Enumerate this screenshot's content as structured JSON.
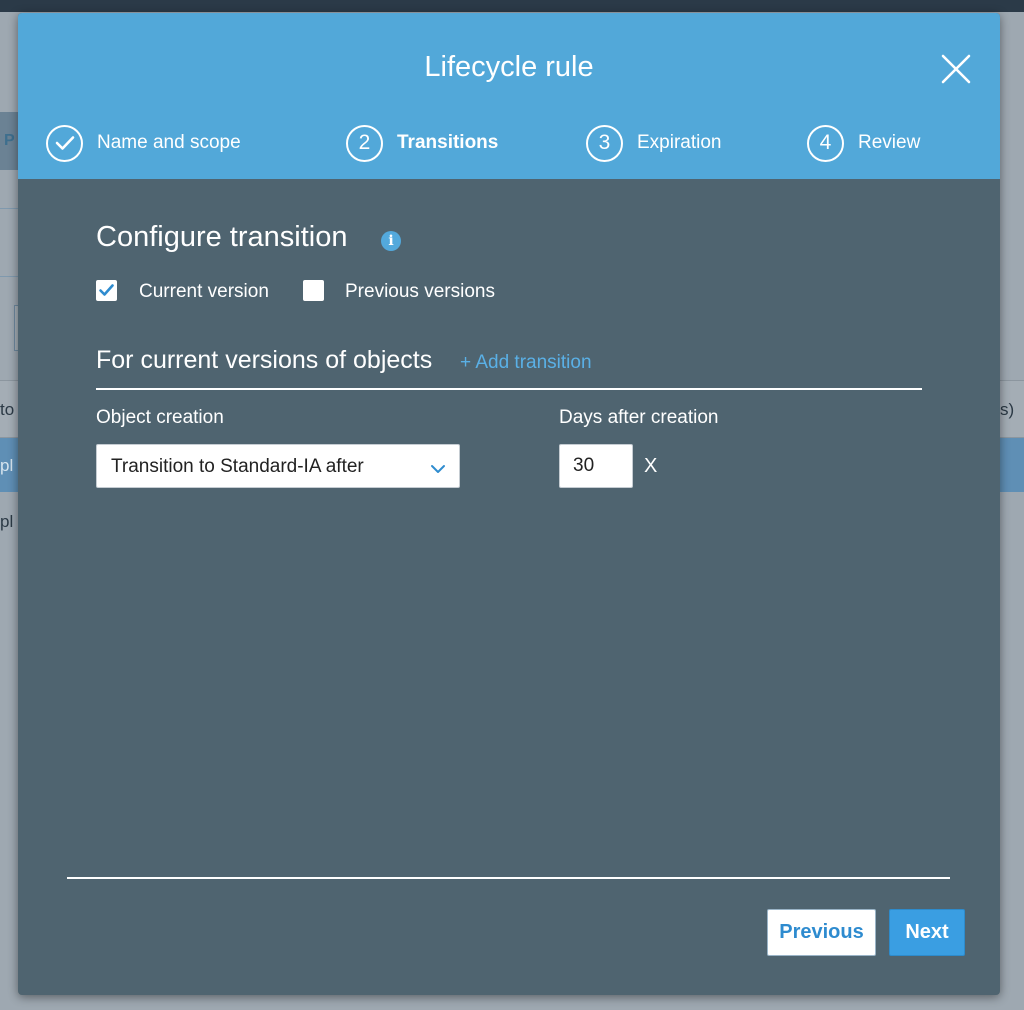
{
  "background": {
    "tab_fragment": "P",
    "header_fragment_left": "to",
    "header_fragment_right": "s)",
    "row_fragment_1": "pl",
    "row_fragment_2": "pl"
  },
  "modal": {
    "title": "Lifecycle rule",
    "close_icon": "close-icon"
  },
  "steps": [
    {
      "number": "",
      "label": "Name and scope",
      "state": "completed",
      "icon": "check-icon"
    },
    {
      "number": "2",
      "label": "Transitions",
      "state": "current"
    },
    {
      "number": "3",
      "label": "Expiration",
      "state": "upcoming"
    },
    {
      "number": "4",
      "label": "Review",
      "state": "upcoming"
    }
  ],
  "configure": {
    "title": "Configure transition",
    "info_icon": "info-icon",
    "current_version_label": "Current version",
    "current_version_checked": true,
    "previous_versions_label": "Previous versions",
    "previous_versions_checked": false
  },
  "current_versions": {
    "title": "For current versions of objects",
    "add_transition": "+ Add transition",
    "object_creation_label": "Object creation",
    "object_creation_value": "Transition to Standard-IA after",
    "days_label": "Days after creation",
    "days_value": "30",
    "remove_label": "X"
  },
  "footer": {
    "previous_label": "Previous",
    "next_label": "Next"
  },
  "colors": {
    "header": "#52a8d9",
    "body": "#4f6470",
    "link": "#5ab0e6",
    "primary_button": "#3a9ee2"
  }
}
